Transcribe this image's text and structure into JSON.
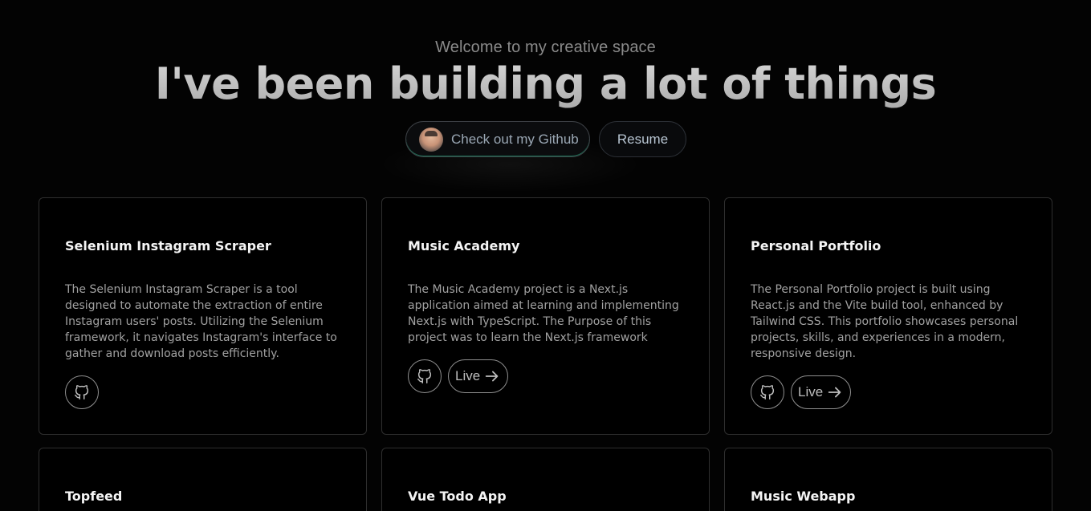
{
  "hero": {
    "subtitle": "Welcome to my creative space",
    "headline": "I've been building a lot of things",
    "github_button": "Check out my Github",
    "resume_button": "Resume"
  },
  "projects": [
    {
      "title": "Selenium Instagram Scraper",
      "description": "The Selenium Instagram Scraper is a tool designed to automate the extraction of entire Instagram users' posts. Utilizing the Selenium framework, it navigates Instagram's interface to gather and download posts efficiently.",
      "icons": [
        "github-icon"
      ]
    },
    {
      "title": "Music Academy",
      "description": "The Music Academy project is a Next.js application aimed at learning and implementing Next.js with TypeScript. The Purpose of this project was to learn the Next.js framework",
      "icons": [
        "github-icon"
      ],
      "live_label": "Live"
    },
    {
      "title": "Personal Portfolio",
      "description": "The Personal Portfolio project is built using React.js and the Vite build tool, enhanced by Tailwind CSS. This portfolio showcases personal projects, skills, and experiences in a modern, responsive design.",
      "icons": [
        "github-icon"
      ],
      "live_label": "Live"
    },
    {
      "title": "Topfeed"
    },
    {
      "title": "Vue Todo App"
    },
    {
      "title": "Music Webapp"
    }
  ],
  "colors": {
    "background": "#030303",
    "card_border": "#2e2e2e",
    "accent_glow": "#2ec896"
  }
}
